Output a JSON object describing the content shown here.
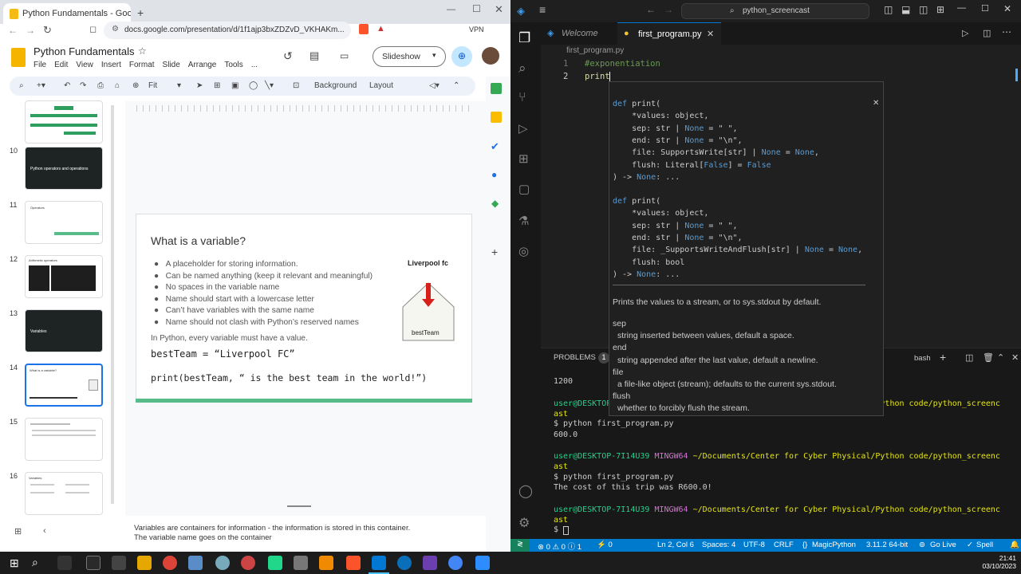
{
  "browser": {
    "tab_title": "Python Fundamentals - Google",
    "url": "docs.google.com/presentation/d/1f1ajp3bxZDZvD_VKHAKm...",
    "vpn_label": "VPN"
  },
  "slides_app": {
    "title": "Python Fundamentals",
    "menu": [
      "File",
      "Edit",
      "View",
      "Insert",
      "Format",
      "Slide",
      "Arrange",
      "Tools",
      "..."
    ],
    "slideshow_label": "Slideshow",
    "toolbar": {
      "zoom": "Fit",
      "background": "Background",
      "layout": "Layout"
    },
    "thumbnails": [
      {
        "num": "10",
        "title": "Python operators and operations"
      },
      {
        "num": "11",
        "title": "Operators"
      },
      {
        "num": "12",
        "title": "Arithmetic operators"
      },
      {
        "num": "13",
        "title": "Variables"
      },
      {
        "num": "14",
        "title": "What is a variable?"
      },
      {
        "num": "15",
        "title": ""
      },
      {
        "num": "16",
        "title": "Variables"
      }
    ],
    "slide": {
      "title": "What is a variable?",
      "bullets": [
        "A placeholder for storing information.",
        "Can be named anything (keep it relevant and meaningful)",
        "No spaces in the variable name",
        "Name should start with a lowercase letter",
        "Can’t have variables with the same name",
        "Name should not clash with Python’s reserved names"
      ],
      "note": "In Python, every variable must have a value.",
      "code1": "bestTeam = “Liverpool FC”",
      "code2": "print(bestTeam, “ is the best team in the world!”)",
      "box_label": "Liverpool fc",
      "box_caption": "bestTeam"
    },
    "speaker_notes": [
      "Variables are containers for information - the information is stored in this container.",
      "The variable name goes on the container"
    ]
  },
  "vscode": {
    "search": "python_screencast",
    "tabs": [
      {
        "label": "Welcome"
      },
      {
        "label": "first_program.py"
      }
    ],
    "breadcrumb": "first_program.py",
    "lines": [
      {
        "num": "1",
        "text": "#exponentiation"
      },
      {
        "num": "2",
        "text": "print"
      }
    ],
    "suggestion": "print",
    "hover": {
      "sig1": [
        "def print(",
        "    *values: object,",
        "    sep: str | None = \" \",",
        "    end: str | None = \"\\n\",",
        "    file: SupportsWrite[str] | None = None,",
        "    flush: Literal[False] = False",
        ") -> None: ..."
      ],
      "sig2": [
        "def print(",
        "    *values: object,",
        "    sep: str | None = \" \",",
        "    end: str | None = \"\\n\",",
        "    file: _SupportsWriteAndFlush[str] | None = None,",
        "    flush: bool",
        ") -> None: ..."
      ],
      "doc": "Prints the values to a stream, or to sys.stdout by default.",
      "params": [
        {
          "name": "sep",
          "desc": "string inserted between values, default a space."
        },
        {
          "name": "end",
          "desc": "string appended after the last value, default a newline."
        },
        {
          "name": "file",
          "desc": "a file-like object (stream); defaults to the current sys.stdout."
        },
        {
          "name": "flush",
          "desc": "whether to forcibly flush the stream."
        }
      ]
    },
    "panel": {
      "problems_label": "PROBLEMS",
      "problems_count": "1",
      "shell": "bash"
    },
    "terminal": [
      {
        "kind": "out",
        "text": "1200"
      },
      {
        "kind": "prompt",
        "user": "user@DESKTOP-7I14U39",
        "env": "MINGW64",
        "path": "~/Documents/Center for Cyber Physical/Python code/python_screencast"
      },
      {
        "kind": "cmd",
        "text": "$ python first_program.py"
      },
      {
        "kind": "out",
        "text": "600.0"
      },
      {
        "kind": "prompt",
        "user": "user@DESKTOP-7I14U39",
        "env": "MINGW64",
        "path": "~/Documents/Center for Cyber Physical/Python code/python_screencast"
      },
      {
        "kind": "cmd",
        "text": "$ python first_program.py"
      },
      {
        "kind": "out",
        "text": "The cost of this trip was R600.0!"
      },
      {
        "kind": "prompt",
        "user": "user@DESKTOP-7I14U39",
        "env": "MINGW64",
        "path": "~/Documents/Center for Cyber Physical/Python code/python_screencast"
      },
      {
        "kind": "cmd",
        "text": "$ "
      }
    ],
    "status": {
      "problems": "⊗ 0 ⚠ 0 ⓘ 1",
      "ports": "⚡ 0",
      "position": "Ln 2, Col 6",
      "spaces": "Spaces: 4",
      "encoding": "UTF-8",
      "eol": "CRLF",
      "ext": "MagicPython",
      "interpreter": "3.11.2 64-bit",
      "golive": "Go Live",
      "spell": "Spell"
    }
  },
  "taskbar": {
    "time": "21:41",
    "date": "03/10/2023"
  },
  "colors": {
    "accent": "#1a73e8",
    "vscode_status": "#007acc",
    "slide_green": "#57bb8a"
  }
}
